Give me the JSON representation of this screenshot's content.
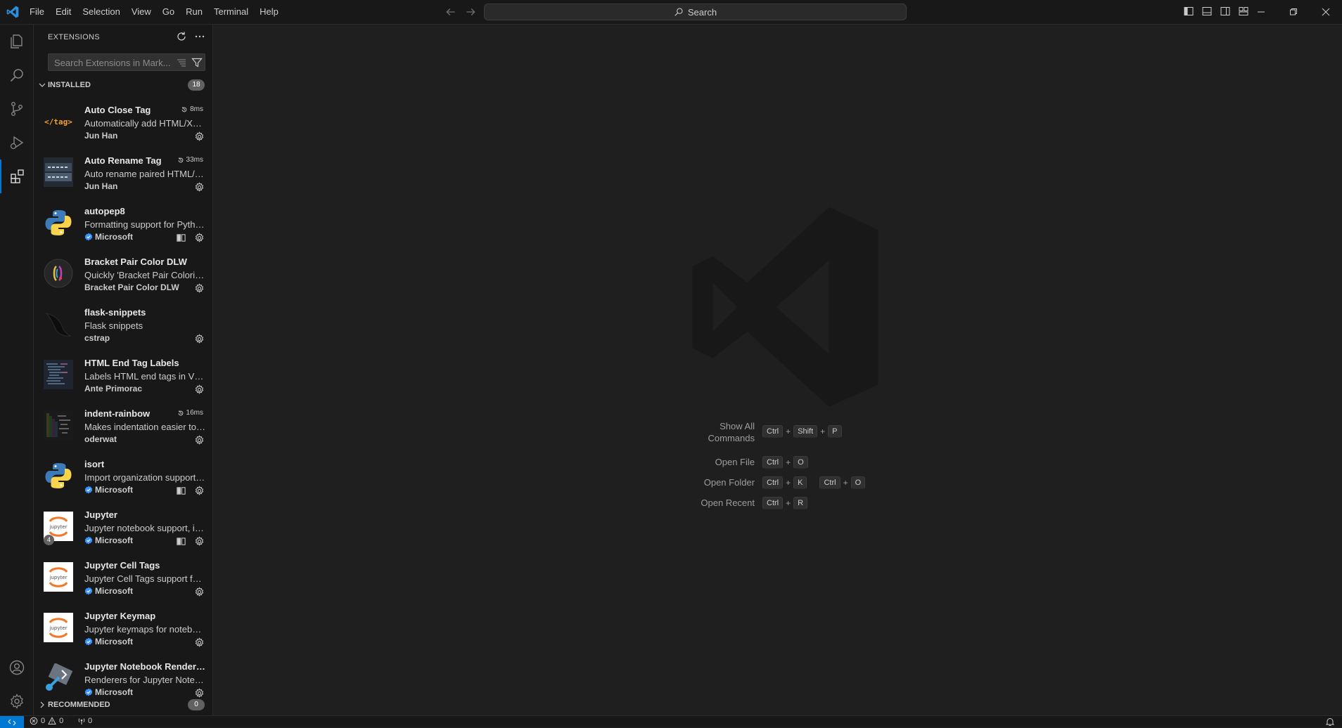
{
  "menu": [
    "File",
    "Edit",
    "Selection",
    "View",
    "Go",
    "Run",
    "Terminal",
    "Help"
  ],
  "search": {
    "label": "Search"
  },
  "sidebar": {
    "title": "EXTENSIONS",
    "search_placeholder": "Search Extensions in Mark...",
    "installed_label": "INSTALLED",
    "installed_count": "18",
    "recommended_label": "RECOMMENDED",
    "recommended_count": "0"
  },
  "extensions": [
    {
      "name": "Auto Close Tag",
      "description": "Automatically add HTML/XML close tag",
      "publisher": "Jun Han",
      "verified": false,
      "time": "8ms",
      "icon": "tag-icon",
      "sync": false
    },
    {
      "name": "Auto Rename Tag",
      "description": "Auto rename paired HTML/XML tag",
      "publisher": "Jun Han",
      "verified": false,
      "time": "33ms",
      "icon": "rename-tag-icon",
      "sync": false
    },
    {
      "name": "autopep8",
      "description": "Formatting support for Python files",
      "publisher": "Microsoft",
      "verified": true,
      "time": "",
      "icon": "python-icon",
      "sync": true
    },
    {
      "name": "Bracket Pair Color DLW",
      "description": "Quickly 'Bracket Pair Colorizer'",
      "publisher": "Bracket Pair Color DLW",
      "verified": false,
      "time": "",
      "icon": "bracket-pair-icon",
      "sync": false
    },
    {
      "name": "flask-snippets",
      "description": "Flask snippets",
      "publisher": "cstrap",
      "verified": false,
      "time": "",
      "icon": "flask-icon",
      "sync": false
    },
    {
      "name": "HTML End Tag Labels",
      "description": "Labels HTML end tags in VS Code",
      "publisher": "Ante Primorac",
      "verified": false,
      "time": "",
      "icon": "code-thumbnail-icon",
      "sync": false
    },
    {
      "name": "indent-rainbow",
      "description": "Makes indentation easier to read",
      "publisher": "oderwat",
      "verified": false,
      "time": "16ms",
      "icon": "indent-rainbow-icon",
      "sync": false
    },
    {
      "name": "isort",
      "description": "Import organization support for Python",
      "publisher": "Microsoft",
      "verified": true,
      "time": "",
      "icon": "python-icon",
      "sync": true
    },
    {
      "name": "Jupyter",
      "description": "Jupyter notebook support, interactive programming",
      "publisher": "Microsoft",
      "verified": true,
      "time": "",
      "icon": "jupyter-icon",
      "sync": true,
      "badge": "4"
    },
    {
      "name": "Jupyter Cell Tags",
      "description": "Jupyter Cell Tags support for VS Code",
      "publisher": "Microsoft",
      "verified": true,
      "time": "",
      "icon": "jupyter-icon",
      "sync": false
    },
    {
      "name": "Jupyter Keymap",
      "description": "Jupyter keymaps for notebooks",
      "publisher": "Microsoft",
      "verified": true,
      "time": "",
      "icon": "jupyter-icon",
      "sync": false
    },
    {
      "name": "Jupyter Notebook Renderers",
      "description": "Renderers for Jupyter Notebooks",
      "publisher": "Microsoft",
      "verified": true,
      "time": "",
      "icon": "renderers-icon",
      "sync": false
    }
  ],
  "shortcuts": [
    {
      "label": "Show All Commands",
      "chords": [
        [
          "Ctrl",
          "Shift",
          "P"
        ]
      ]
    },
    {
      "label": "Open File",
      "chords": [
        [
          "Ctrl",
          "O"
        ]
      ]
    },
    {
      "label": "Open Folder",
      "chords": [
        [
          "Ctrl",
          "K"
        ],
        [
          "Ctrl",
          "O"
        ]
      ]
    },
    {
      "label": "Open Recent",
      "chords": [
        [
          "Ctrl",
          "R"
        ]
      ]
    }
  ],
  "statusbar": {
    "errors": "0",
    "warnings": "0",
    "ports": "0"
  },
  "colors": {
    "accent": "#0078d4",
    "background": "#1f1f1f",
    "chrome": "#181818"
  }
}
